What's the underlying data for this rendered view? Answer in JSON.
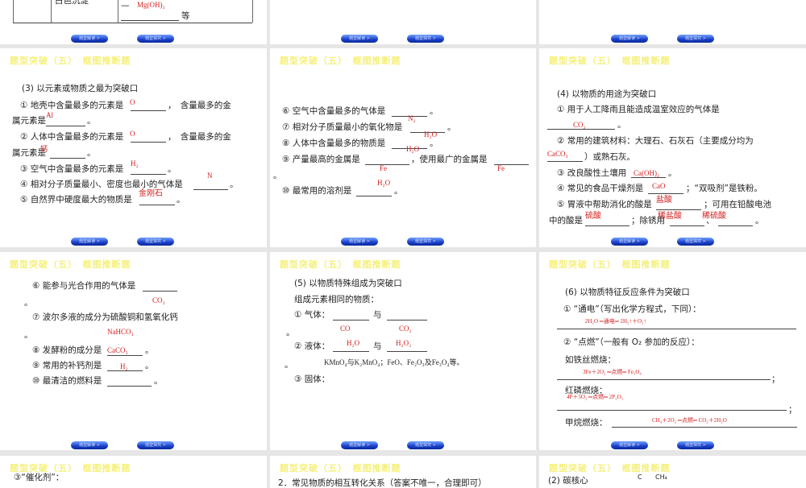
{
  "header": "题型突破（五）　框图推断题",
  "buttons": {
    "read": "题型解读 >",
    "explore": "题型探究 >"
  },
  "s0": {
    "cell": "白色沉淀",
    "dash": "—",
    "ans": "Mg(OH)₂",
    "suffix": "等"
  },
  "s3": {
    "title": "(3) 以元素或物质之最为突破口",
    "l1a": "① 地壳中含量最多的元素是",
    "l1b": "，　含量最多的金",
    "l1c": "属元素是",
    "l1d": "。",
    "l2a": "② 人体中含量最多的元素是",
    "l2b": "，　含量最多的金",
    "l2c": "属元素是",
    "l2d": "。",
    "l3": "③ 空气中含量最多的元素是",
    "l3d": "。",
    "l4": "④ 相对分子质量最小、密度也最小的气体是",
    "l4d": "。",
    "l5": "⑤ 自然界中硬度最大的物质是",
    "l5d": "。",
    "answers": [
      "O",
      "Al",
      "O",
      "钙",
      "H₂",
      "N",
      "金刚石"
    ]
  },
  "s4": {
    "l6": "⑥ 空气中含量最多的气体是",
    "l7": "⑦ 相对分子质量最小的氧化物是",
    "l8": "⑧ 人体中含量最多的物质是",
    "l9a": "⑨ 产量最高的金属是",
    "l9b": "，使用最广的金属是",
    "l10": "⑩ 最常用的溶剂是",
    "dot": "。",
    "answers": [
      "N₂",
      "H₂O",
      "H₂O",
      "Fe",
      "Fe",
      "H₂O"
    ]
  },
  "s5": {
    "title": "(4) 以物质的用途为突破口",
    "l1": "① 用于人工降雨且能造成温室效应的气体是",
    "l2": "② 常用的建筑材料：大理石、石灰石（主要成分均为",
    "l2b": "）或熟石灰。",
    "l3": "③ 改良酸性土壤用",
    "l4": "④ 常见的食品干燥剂是",
    "l4b": "；“双吸剂”是铁粉。",
    "l5": "⑤ 胃液中帮助消化的酸是",
    "l5b": "；可用在铅酸电池",
    "l6": "中的酸是",
    "l6b": "；除锈用",
    "l6c": "、",
    "dot": "。",
    "answers": [
      "CO₂",
      "CaCO₃",
      "Ca(OH)₂",
      "CaO",
      "盐酸",
      "硫酸",
      "稀盐酸",
      "稀硫酸"
    ]
  },
  "s6": {
    "l6": "⑥ 能参与光合作用的气体是",
    "l7": "⑦ 波尔多液的成分为硫酸铜和氢氧化钙",
    "l8": "⑧ 发酵粉的成分是",
    "l9": "⑨ 常用的补钙剂是",
    "l10": "⑩ 最清洁的燃料是",
    "dot": "。",
    "answers": [
      "CO₂",
      "NaHCO₃",
      "CaCO₃",
      "H₂"
    ]
  },
  "s7": {
    "title": "(5) 以物质特殊组成为突破口",
    "sub": "组成元素相同的物质：",
    "l1": "① 气体：",
    "l2": "② 液体：",
    "with": "与",
    "l3": "③ 固体：",
    "dot": "。",
    "solid": "KMnO₄与K₂MnO₄；FeO、Fe₂O₃及Fe₃O₄等。",
    "answers": [
      "CO",
      "CO₂",
      "H₂O",
      "H₂O₂"
    ]
  },
  "s8": {
    "title": "(6) 以物质特征反应条件为突破口",
    "l1": "① “通电”（写出化学方程式，下同）：",
    "l2": "② “点燃”（一般有 O₂ 参加的反应）：",
    "iron": "如铁丝燃烧：",
    "phos": "红磷燃烧：",
    "methane": "甲烷燃烧：",
    "semi": "；",
    "answers": [
      "2H₂O ═通电═ 2H₂↑＋O₂↑",
      "3Fe＋2O₂ ═点燃═ Fe₃O₄",
      "4P＋5O₂ ═点燃═ 2P₂O₅",
      "CH₄＋2O₂ ═点燃═ CO₂＋2H₂O"
    ]
  },
  "s9": {
    "text": "③“催化剂”："
  },
  "s10": {
    "text": "2．常见物质的相互转化关系（答案不唯一，合理即可）"
  },
  "s11": {
    "text": "(2) 碳核心",
    "c": "C",
    "ch4": "CH₄"
  }
}
